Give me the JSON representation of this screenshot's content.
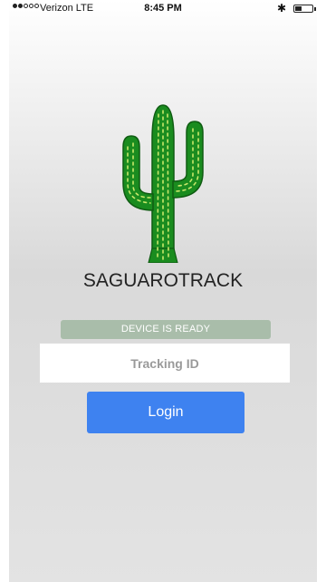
{
  "status_bar": {
    "carrier": "Verizon  LTE",
    "time": "8:45 PM",
    "bluetooth_icon": "bluetooth-icon",
    "battery_icon": "battery-icon",
    "signal_icon": "signal-dots-icon"
  },
  "app": {
    "logo_icon": "cactus-icon",
    "title": "SAGUAROTRACK"
  },
  "device_status": {
    "text": "DEVICE IS READY",
    "color": "#a9bdaa"
  },
  "tracking": {
    "placeholder": "Tracking ID",
    "value": ""
  },
  "login": {
    "label": "Login",
    "color": "#3e82f0"
  }
}
